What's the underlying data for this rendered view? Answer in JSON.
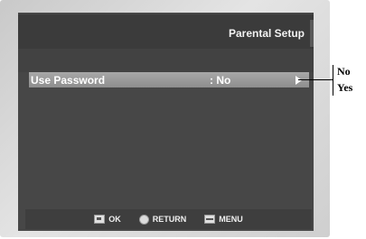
{
  "header": {
    "title": "Parental Setup"
  },
  "menu": {
    "items": [
      {
        "label": "Use Password",
        "value": ": No"
      }
    ]
  },
  "footer": {
    "ok": "OK",
    "return": "RETURN",
    "menu": "MENU"
  },
  "options": [
    "No",
    "Yes"
  ]
}
